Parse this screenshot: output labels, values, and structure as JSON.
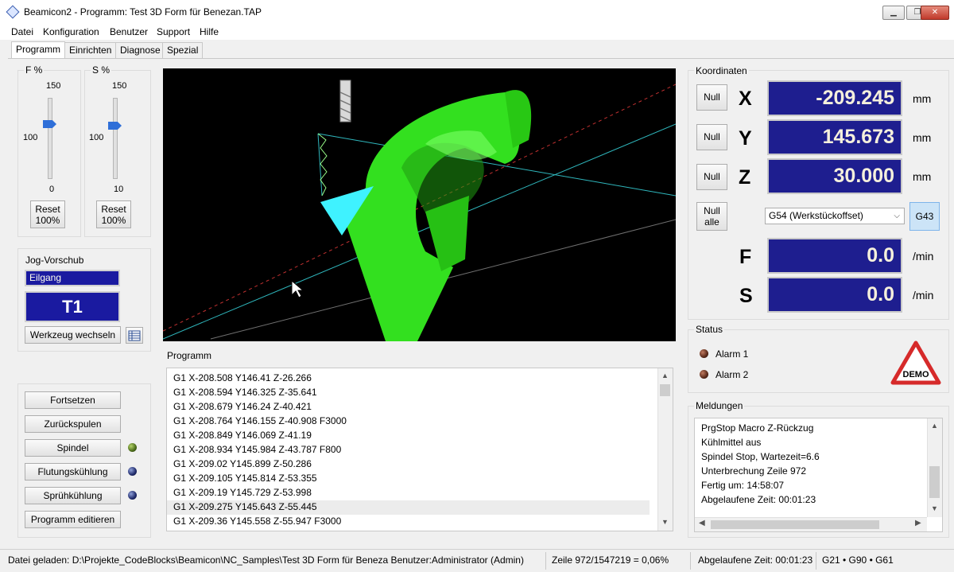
{
  "window": {
    "title": "Beamicon2 - Programm: Test 3D Form für Benezan.TAP"
  },
  "menu": [
    "Datei",
    "Konfiguration",
    "Benutzer",
    "Support",
    "Hilfe"
  ],
  "tabs": [
    "Programm",
    "Einrichten",
    "Diagnose",
    "Spezial"
  ],
  "f_slider": {
    "label": "F %",
    "max": "150",
    "mid": "100",
    "min": "0",
    "reset": "Reset 100%",
    "level": 0.67
  },
  "s_slider": {
    "label": "S %",
    "max": "150",
    "mid": "100",
    "min": "10",
    "reset": "Reset 100%",
    "level": 0.67
  },
  "jog": {
    "title": "Jog-Vorschub",
    "mode": "Eilgang",
    "tool": "T1",
    "change_tool": "Werkzeug wechseln"
  },
  "controls": {
    "fortsetzen": "Fortsetzen",
    "zurueckspulen": "Zurückspulen",
    "spindel": "Spindel",
    "flutungskuehlung": "Flutungskühlung",
    "spruehkuehlung": "Sprühkühlung",
    "edit": "Programm editieren"
  },
  "coords": {
    "title": "Koordinaten",
    "null": "Null",
    "null_all_1": "Null",
    "null_all_2": "alle",
    "x": {
      "axis": "X",
      "value": "-209.245",
      "unit": "mm"
    },
    "y": {
      "axis": "Y",
      "value": "145.673",
      "unit": "mm"
    },
    "z": {
      "axis": "Z",
      "value": "30.000",
      "unit": "mm"
    },
    "offset": "G54 (Werkstückoffset)",
    "g43": "G43",
    "f": {
      "axis": "F",
      "value": "0.0",
      "unit": "/min"
    },
    "s": {
      "axis": "S",
      "value": "0.0",
      "unit": "/min"
    }
  },
  "status": {
    "title": "Status",
    "alarm1": "Alarm 1",
    "alarm2": "Alarm 2",
    "demo": "DEMO"
  },
  "program": {
    "title": "Programm",
    "lines": [
      "G1 X-208.508 Y146.41 Z-26.266",
      "G1 X-208.594 Y146.325 Z-35.641",
      "G1 X-208.679 Y146.24 Z-40.421",
      "G1 X-208.764 Y146.155 Z-40.908 F3000",
      "G1 X-208.849 Y146.069 Z-41.19",
      "G1 X-208.934 Y145.984 Z-43.787 F800",
      "G1 X-209.02 Y145.899 Z-50.286",
      "G1 X-209.105 Y145.814 Z-53.355",
      "G1 X-209.19 Y145.729 Z-53.998",
      "G1 X-209.275 Y145.643 Z-55.445",
      "G1 X-209.36 Y145.558 Z-55.947 F3000"
    ]
  },
  "messages": {
    "title": "Meldungen",
    "lines": [
      "PrgStop Macro Z-Rückzug",
      "Kühlmittel aus",
      "Spindel Stop, Wartezeit=6.6",
      "Unterbrechung Zeile 972",
      "Fertig um: 14:58:07",
      "Abgelaufene Zeit: 00:01:23"
    ]
  },
  "statusbar": {
    "file": "Datei geladen: D:\\Projekte_CodeBlocks\\Beamicon\\NC_Samples\\Test 3D Form für Beneza Benutzer:Administrator (Admin)",
    "line": "Zeile 972/1547219 = 0,06%",
    "elapsed": "Abgelaufene Zeit: 00:01:23",
    "modes": "G21 • G90 • G61"
  },
  "colors": {
    "accent_blue": "#1e1e8f",
    "led_green": "#4a6b1a",
    "led_dark": "#5a2a1a",
    "viewport_green": "#33e01f",
    "viewport_cyan": "#3ff2ff",
    "demo_red": "#d62a2a"
  }
}
